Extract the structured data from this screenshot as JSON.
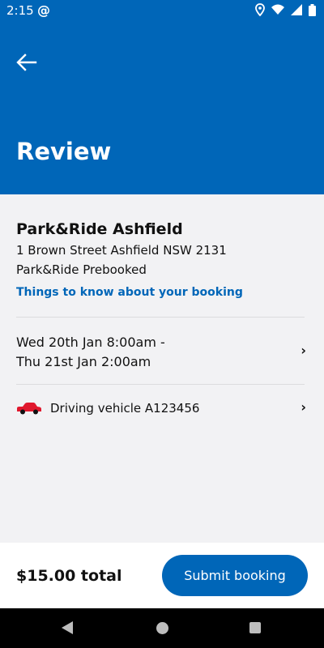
{
  "status_bar": {
    "time": "2:15",
    "app_glyph": "@"
  },
  "header": {
    "title": "Review"
  },
  "booking": {
    "place_name": "Park&Ride Ashfield",
    "address": "1 Brown Street Ashfield  NSW 2131",
    "product": "Park&Ride Prebooked",
    "info_link": "Things to know about your booking",
    "date_line1": "Wed 20th Jan 8:00am -",
    "date_line2": "Thu 21st Jan 2:00am",
    "vehicle": "Driving vehicle A123456"
  },
  "footer": {
    "total": "$15.00 total",
    "submit_label": "Submit booking"
  },
  "colors": {
    "brand_blue": "#0066b8",
    "car_red": "#e0182d"
  },
  "icons": [
    "back-arrow-icon",
    "location-icon",
    "wifi-icon",
    "signal-icon",
    "battery-icon",
    "chevron-right-icon",
    "car-icon"
  ]
}
